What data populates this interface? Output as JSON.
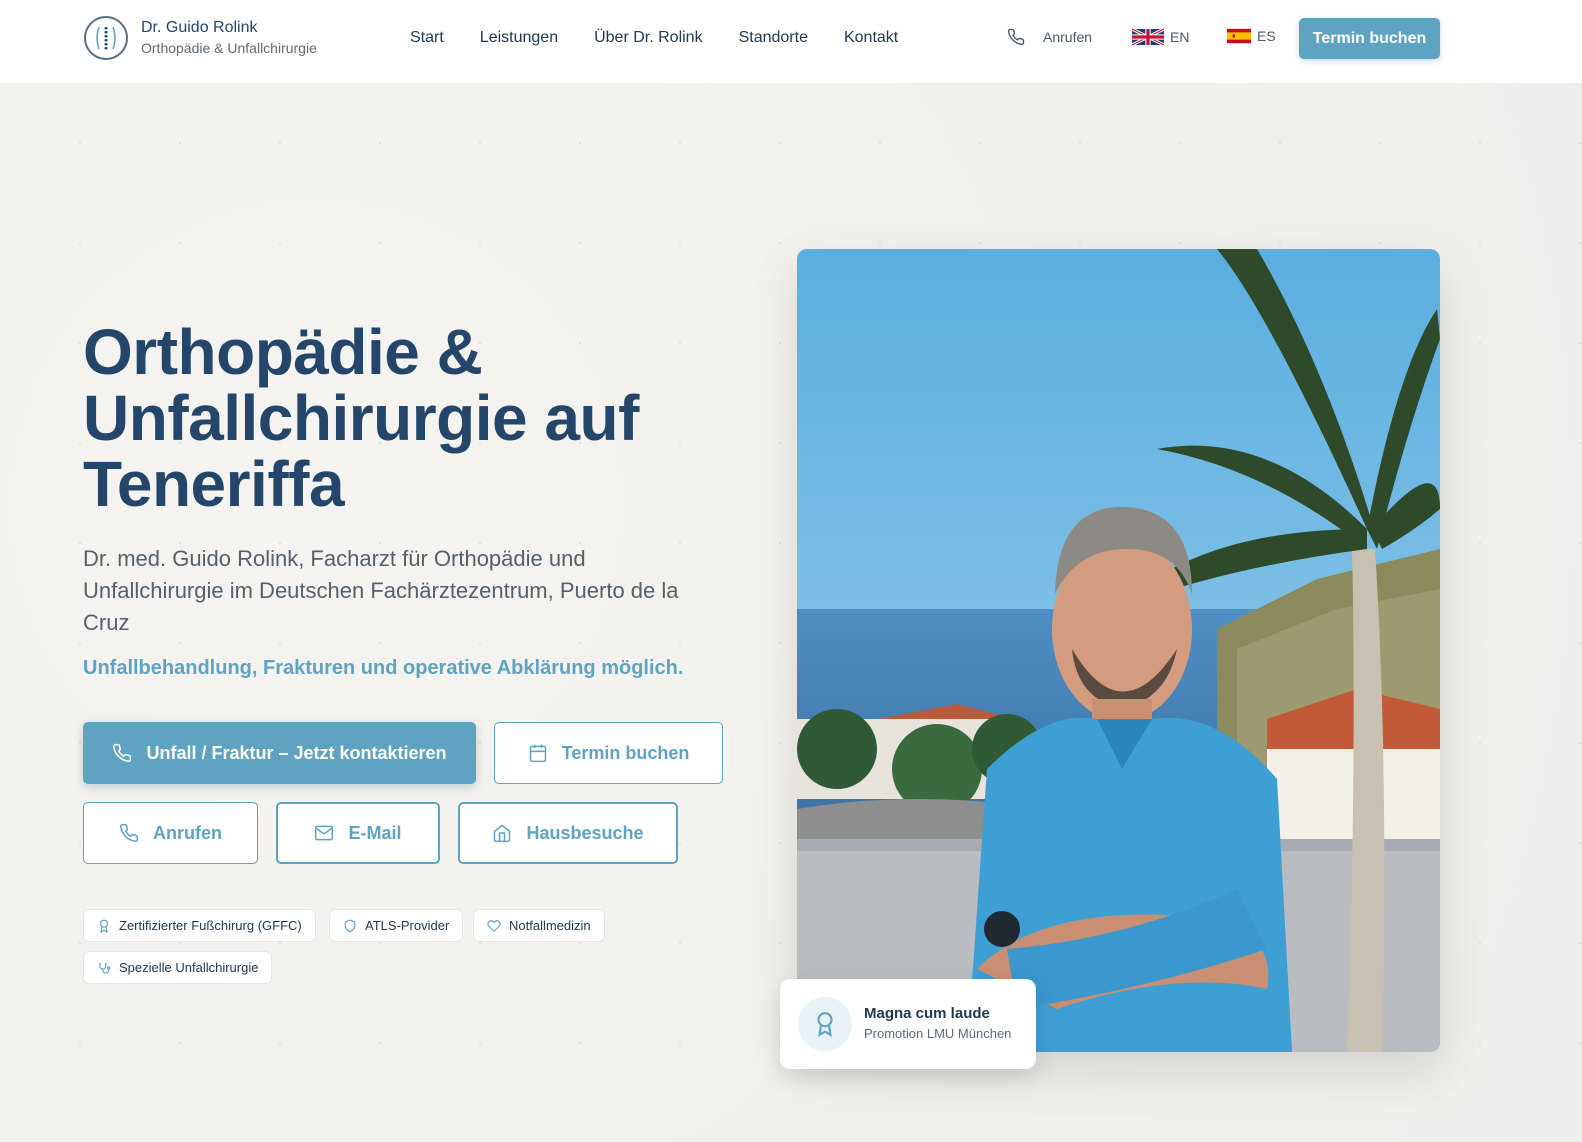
{
  "header": {
    "name": "Dr. Guido Rolink",
    "subtitle": "Orthopädie & Unfallchirurgie",
    "nav": [
      "Start",
      "Leistungen",
      "Über Dr. Rolink",
      "Standorte",
      "Kontakt"
    ],
    "call_label": "Anrufen",
    "lang_en": "EN",
    "lang_es": "ES",
    "book_label": "Termin buchen"
  },
  "hero": {
    "title": "Orthopädie & Unfallchirurgie auf Teneriffa",
    "subtitle": "Dr. med. Guido Rolink, Facharzt für Orthopädie und Unfallchirurgie im Deutschen Fachärztezentrum, Puerto de la Cruz",
    "accent": "Unfallbehandlung, Frakturen und operative Abklärung möglich.",
    "btn_emergency": "Unfall / Fraktur – Jetzt kontaktieren",
    "btn_termin": "Termin buchen",
    "btn_call": "Anrufen",
    "btn_mail": "E-Mail",
    "btn_home": "Hausbesuche",
    "badges": [
      "Zertifizierter Fußchirurg (GFFC)",
      "ATLS-Provider",
      "Notfallmedizin",
      "Spezielle Unfallchirurgie"
    ]
  },
  "award": {
    "title": "Magna cum laude",
    "subtitle": "Promotion LMU München"
  },
  "colors": {
    "primary": "#5ea3c2",
    "navy": "#23466a",
    "background": "#f5f3ef"
  }
}
